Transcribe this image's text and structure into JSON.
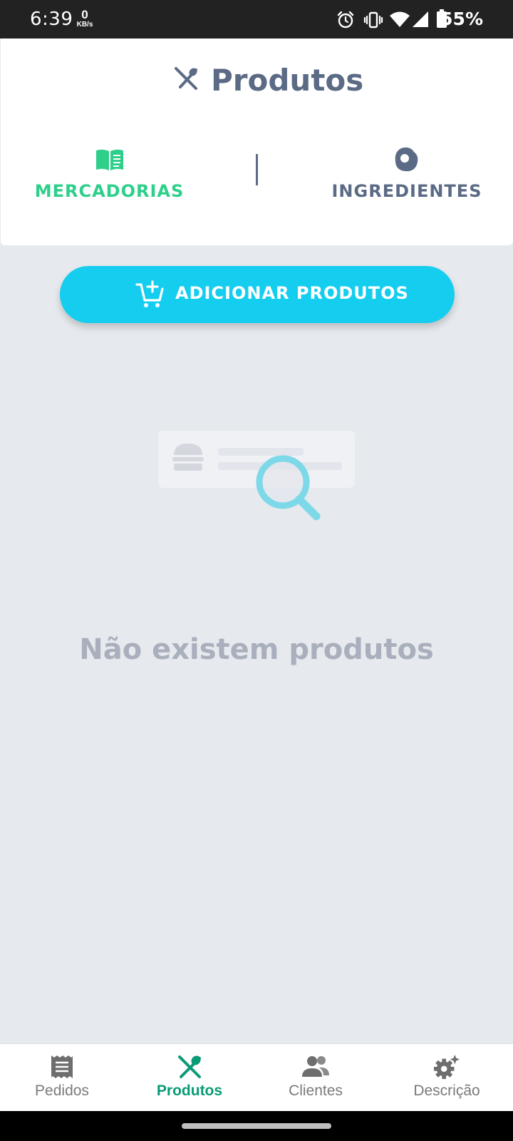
{
  "status_bar": {
    "time": "6:39",
    "net_speed_value": "0",
    "net_speed_unit": "KB/s",
    "battery_percent": "55%",
    "icons": [
      "alarm-icon",
      "vibrate-icon",
      "wifi-icon",
      "cell-signal-icon",
      "battery-icon"
    ]
  },
  "header": {
    "title": "Produtos",
    "title_icon": "utensils-icon",
    "tabs": [
      {
        "label": "MERCADORIAS",
        "icon": "book-icon",
        "active": true
      },
      {
        "label": "INGREDIENTES",
        "icon": "egg-icon",
        "active": false
      }
    ]
  },
  "actions": {
    "add_products_label": "ADICIONAR PRODUTOS",
    "add_products_icon": "cart-plus-icon"
  },
  "empty_state": {
    "message": "Não existem produtos"
  },
  "bottom_nav": {
    "items": [
      {
        "label": "Pedidos",
        "icon": "receipt-icon",
        "active": false
      },
      {
        "label": "Produtos",
        "icon": "utensils-icon",
        "active": true
      },
      {
        "label": "Clientes",
        "icon": "users-icon",
        "active": false
      },
      {
        "label": "Descrição",
        "icon": "gear-sparkle-icon",
        "active": false
      }
    ]
  },
  "colors": {
    "accent_cyan": "#14cdef",
    "active_green": "#2ecf8b",
    "nav_active": "#0a9b77",
    "slate": "#5b6a85",
    "background": "#e6e9ed",
    "empty_text": "#a9afbc"
  }
}
